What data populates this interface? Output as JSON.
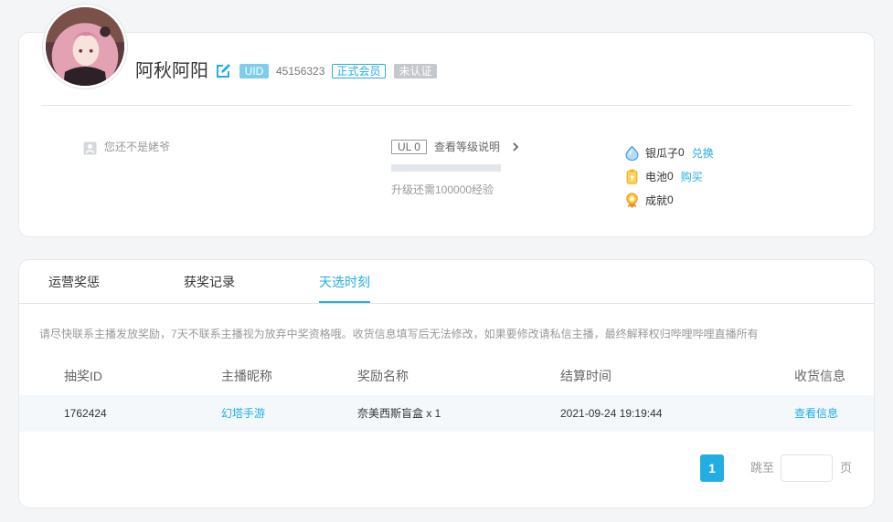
{
  "colors": {
    "accent": "#23ade5",
    "uid_badge": "#7fcdee",
    "unverified_badge": "#c4c7cc",
    "row_highlight": "#f4f8fb",
    "page_bg": "#f4f5f7"
  },
  "profile": {
    "username": "阿秋阿阳",
    "uid_label": "UID",
    "uid": "45156323",
    "member_badge": "正式会员",
    "verify_badge": "未认证"
  },
  "vip": {
    "icon": "vip-icon",
    "text": "您还不是姥爷"
  },
  "level": {
    "badge": "UL 0",
    "link": "查看等级说明",
    "progress": 0,
    "upgrade_text": "升级还需100000经验"
  },
  "assets": [
    {
      "icon": "silver-seed-icon",
      "label": "银瓜子",
      "value": "0",
      "action": "兑换"
    },
    {
      "icon": "battery-icon",
      "label": "电池",
      "value": "0",
      "action": "购买"
    },
    {
      "icon": "achievement-icon",
      "label": "成就",
      "value": "0"
    }
  ],
  "tabs": [
    {
      "label": "运营奖惩",
      "active": false
    },
    {
      "label": "获奖记录",
      "active": false
    },
    {
      "label": "天选时刻",
      "active": true
    }
  ],
  "notice": "请尽快联系主播发放奖励，7天不联系主播视为放弃中奖资格哦。收货信息填写后无法修改，如果要修改请私信主播，最终解释权归哔哩哔哩直播所有",
  "table": {
    "headers": [
      "抽奖ID",
      "主播昵称",
      "奖励名称",
      "结算时间",
      "收货信息"
    ],
    "rows": [
      {
        "id": "1762424",
        "anchor": "幻塔手游",
        "reward": "奈美西斯盲盒 x 1",
        "settle_time": "2021-09-24 19:19:44",
        "shipping": "查看信息"
      }
    ]
  },
  "pagination": {
    "current_page": "1",
    "goto_label": "跳至",
    "goto_value": "",
    "page_unit": "页"
  }
}
